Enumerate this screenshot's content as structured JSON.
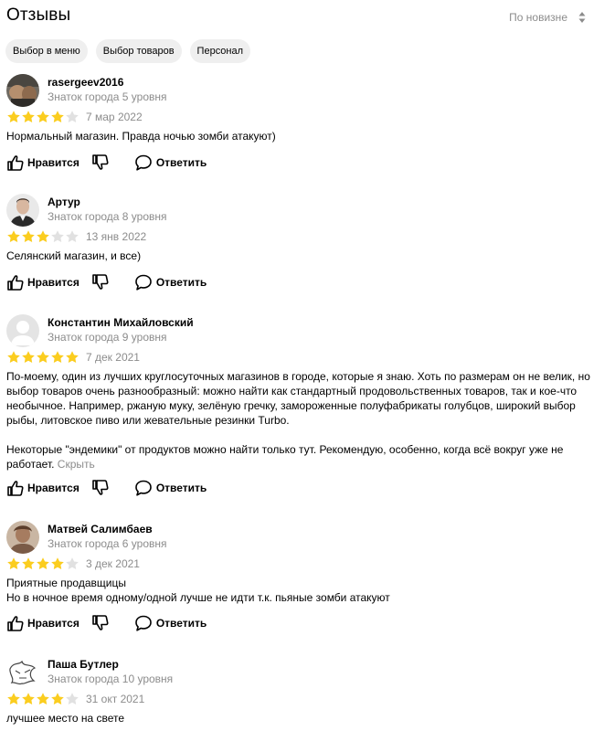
{
  "header": {
    "title": "Отзывы",
    "sort_label": "По новизне"
  },
  "chips": [
    "Выбор в меню",
    "Выбор товаров",
    "Персонал"
  ],
  "actions": {
    "like": "Нравится",
    "reply": "Ответить"
  },
  "colors": {
    "star_filled": "#fbcd1f",
    "star_empty": "#e1e1e1",
    "muted_text": "#8c8c8c",
    "chip_bg": "#efefef"
  },
  "reviews": [
    {
      "author": "rasergeev2016",
      "level": "Знаток города 5 уровня",
      "rating": 4,
      "date": "7 мар 2022",
      "paragraphs": [
        "Нормальный магазин. Правда ночью зомби атакуют)"
      ],
      "avatar": "photo"
    },
    {
      "author": "Артур",
      "level": "Знаток города 8 уровня",
      "rating": 3,
      "date": "13 янв 2022",
      "paragraphs": [
        "Селянский магазин, и все)"
      ],
      "avatar": "photo"
    },
    {
      "author": "Константин Михайловский",
      "level": "Знаток города 9 уровня",
      "rating": 5,
      "date": "7 дек 2021",
      "paragraphs": [
        "По-моему, один из лучших круглосуточных магазинов в городе, которые я знаю. Хоть по размерам он не велик, но выбор товаров очень разнообразный: можно найти как стандартный продовольственных товаров, так и кое-что необычное. Например, ржаную муку, зелёную гречку, замороженные полуфабрикаты голубцов, широкий выбор рыбы, литовское пиво или жевательные резинки Turbo.",
        "Некоторые \"эндемики\" от продуктов можно найти только тут. Рекомендую, особенно, когда всё вокруг уже не работает."
      ],
      "hide_label": "Скрыть",
      "avatar": "placeholder"
    },
    {
      "author": "Матвей Салимбаев",
      "level": "Знаток города 6 уровня",
      "rating": 4,
      "date": "3 дек 2021",
      "paragraphs": [
        "Приятные продавщицы",
        "Но в ночное время одному/одной лучше не идти т.к. пьяные зомби атакуют"
      ],
      "avatar": "photo"
    },
    {
      "author": "Паша Бутлер",
      "level": "Знаток города 10 уровня",
      "rating": 4,
      "date": "31 окт 2021",
      "paragraphs": [
        "лучшее место на свете"
      ],
      "avatar": "drawing"
    }
  ]
}
